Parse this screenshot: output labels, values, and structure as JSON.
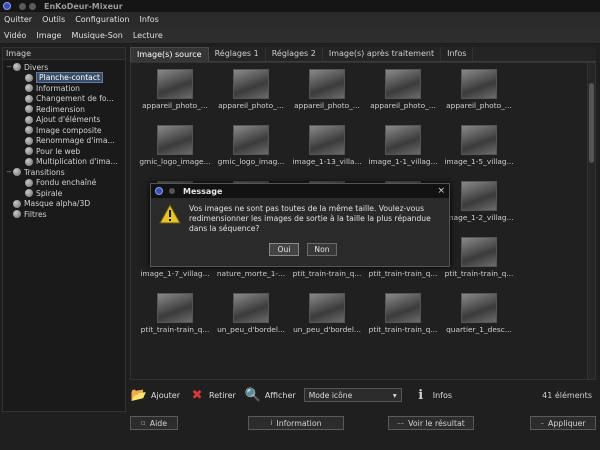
{
  "window": {
    "title": "EnKoDeur-Mixeur"
  },
  "menu": [
    "Quitter",
    "Outils",
    "Configuration",
    "Infos"
  ],
  "modes": [
    "Vidéo",
    "Image",
    "Musique-Son",
    "Lecture"
  ],
  "left_panel": {
    "title": "Image",
    "tree": [
      {
        "label": "Divers",
        "level": 0,
        "expanded": true
      },
      {
        "label": "Planche-contact",
        "level": 1,
        "selected": true
      },
      {
        "label": "Information",
        "level": 1
      },
      {
        "label": "Changement de fo...",
        "level": 1
      },
      {
        "label": "Redimension",
        "level": 1
      },
      {
        "label": "Ajout d'éléments",
        "level": 1
      },
      {
        "label": "Image composite",
        "level": 1
      },
      {
        "label": "Renommage d'ima...",
        "level": 1
      },
      {
        "label": "Pour le web",
        "level": 1
      },
      {
        "label": "Multiplication d'ima...",
        "level": 1
      },
      {
        "label": "Transitions",
        "level": 0,
        "expanded": true
      },
      {
        "label": "Fondu enchaîné",
        "level": 1
      },
      {
        "label": "Spirale",
        "level": 1
      },
      {
        "label": "Masque alpha/3D",
        "level": 0
      },
      {
        "label": "Filtres",
        "level": 0
      }
    ]
  },
  "tabs": [
    "Image(s) source",
    "Réglages 1",
    "Réglages 2",
    "Image(s) après traitement",
    "Infos"
  ],
  "thumbnails": [
    "appareil_photo_...",
    "appareil_photo_...",
    "appareil_photo_...",
    "appareil_photo_...",
    "appareil_photo_...",
    "gmic_logo_image...",
    "gmic_logo_imag...",
    "image_1-13_villa...",
    "image_1-1_villag...",
    "image_1-5_villag...",
    "ima",
    "",
    "",
    "",
    "image_1-2_villag...",
    "image_1-7_villag...",
    "nature_morte_1-...",
    "ptit_train-train_q...",
    "ptit_train-train_q...",
    "ptit_train-train_q...",
    "ptit_train-train_q...",
    "un_peu_d'bordel...",
    "un_peu_d'bordel...",
    "ptit_train-train_q...",
    "quartier_1_desc..."
  ],
  "actions": {
    "add": "Ajouter",
    "remove": "Retirer",
    "show": "Afficher",
    "view_mode": "Mode icône",
    "info": "Infos",
    "count": "41 éléments"
  },
  "bottom": {
    "help": "Aide",
    "information": "Information",
    "preview": "Voir le résultat",
    "apply": "Appliquer"
  },
  "dialog": {
    "title": "Message",
    "close": "×",
    "text": "Vos images ne sont pas toutes de la même taille. Voulez-vous redimensionner les images de sortie à la taille la plus répandue dans la séquence?",
    "yes": "Oui",
    "no": "Non"
  },
  "colors": {
    "accent": "#3b4d66",
    "remove_icon": "#d63a3a",
    "warning": "#e8c22a"
  }
}
